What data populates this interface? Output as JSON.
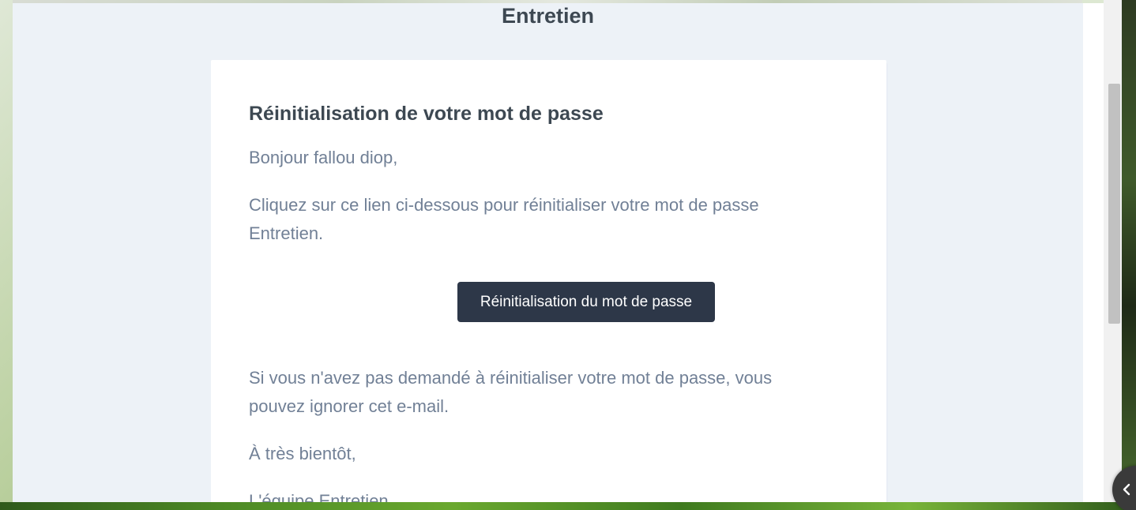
{
  "email": {
    "brand": "Entretien",
    "title": "Réinitialisation de votre mot de passe",
    "greeting": "Bonjour fallou diop,",
    "intro": "Cliquez sur ce lien ci-dessous pour réinitialiser votre mot de passe Entretien.",
    "button_label": "Réinitialisation du mot de passe",
    "ignore_note": "Si vous n'avez pas demandé à réinitialiser votre mot de passe, vous pouvez ignorer cet e-mail.",
    "regards": "À très bientôt,",
    "signature": "L'équipe Entretien"
  },
  "colors": {
    "button_bg": "#2d3748",
    "heading": "#3d4852",
    "body_text": "#718096",
    "wrapper_bg": "#edf2f7"
  },
  "widgets": {
    "collapse_icon": "chevron-left-icon"
  }
}
